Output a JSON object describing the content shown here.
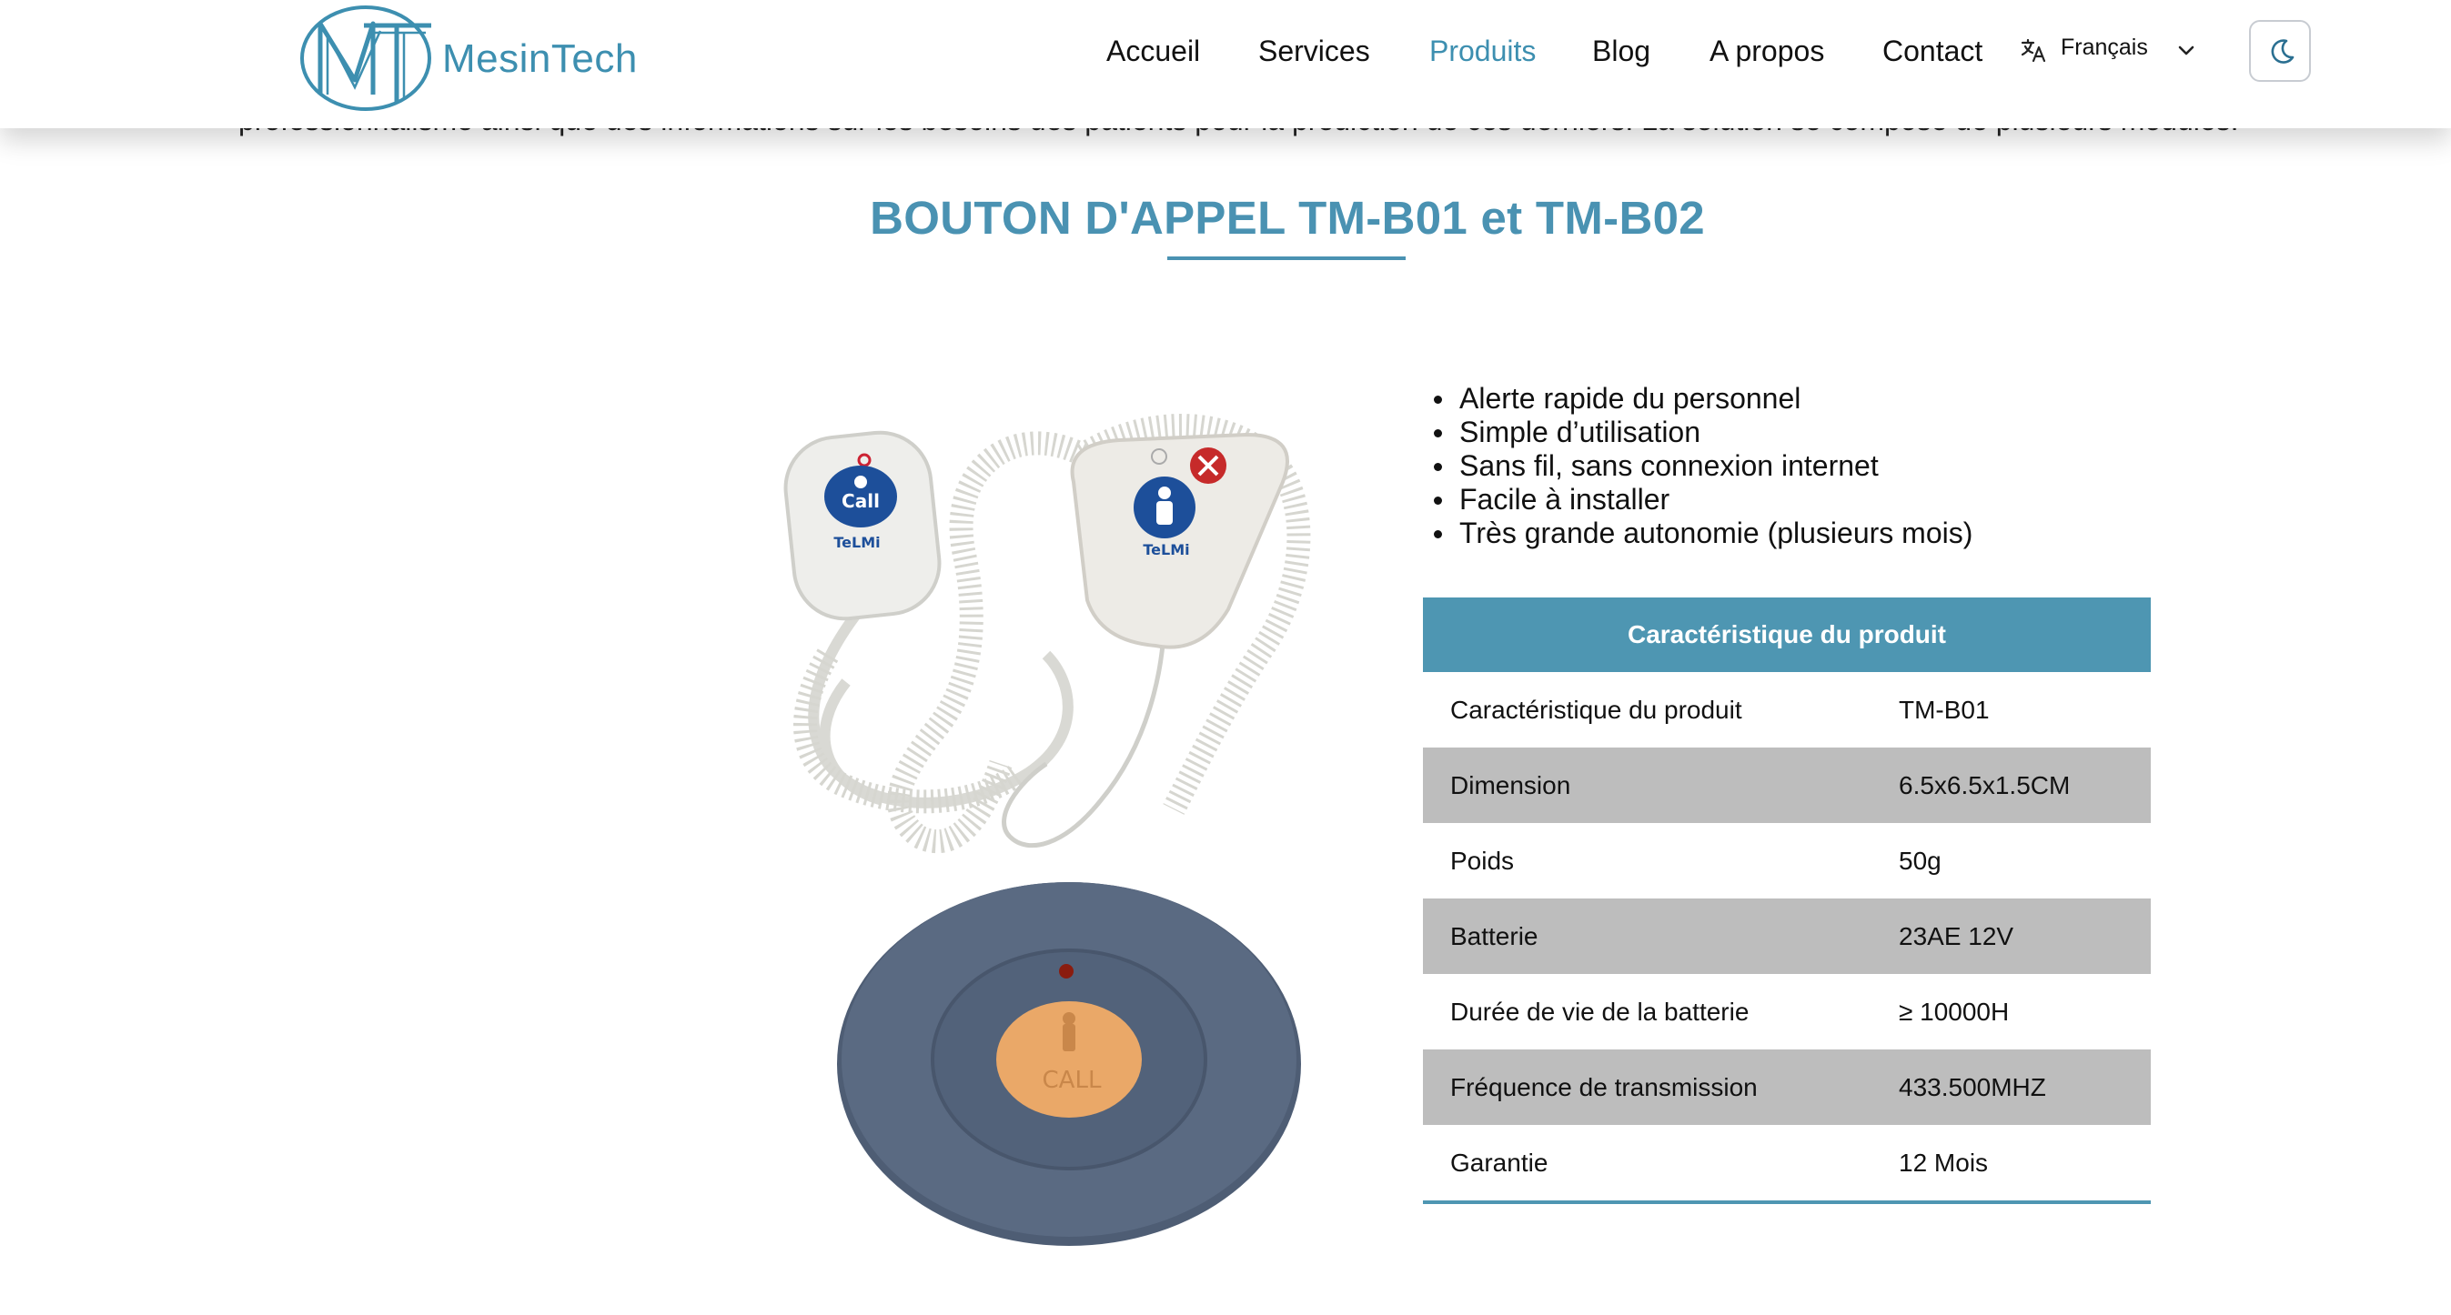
{
  "intro_text_fragment": "professionnalisme ainsi que des informations sur les besoins des patients pour la prédiction de ces derniers. La solution se compose de plusieurs modules.",
  "header": {
    "logo_text": "MesinTech",
    "nav": [
      {
        "label": "Accueil"
      },
      {
        "label": "Services"
      },
      {
        "label": "Produits",
        "active": true
      },
      {
        "label": "Blog"
      },
      {
        "label": "A propos"
      },
      {
        "label": "Contact"
      }
    ],
    "language": {
      "selected": "Français",
      "icon": "translate-icon"
    },
    "theme_toggle_icon": "moon-icon",
    "accent_color": "#3d8fb0"
  },
  "page_title": "BOUTON D'APPEL TM-B01 et TM-B02",
  "product_image": {
    "pendant_labels": {
      "call_small": "Call",
      "brand": "TeLMi"
    },
    "disc_button_label": "CALL"
  },
  "features": [
    "Alerte rapide du personnel",
    "Simple d’utilisation",
    "Sans fil, sans connexion internet",
    "Facile à installer",
    "Très grande autonomie (plusieurs mois)"
  ],
  "spec_table": {
    "header": "Caractéristique du produit",
    "header_color": "#4e96b2",
    "rows": [
      {
        "key": "Caractéristique du produit",
        "value": "TM-B01"
      },
      {
        "key": "Dimension",
        "value": "6.5x6.5x1.5CM"
      },
      {
        "key": "Poids",
        "value": "50g"
      },
      {
        "key": "Batterie",
        "value": "23AE 12V"
      },
      {
        "key": "Durée de vie de la batterie",
        "value": "≥ 10000H"
      },
      {
        "key": "Fréquence de transmission",
        "value": "433.500MHZ"
      },
      {
        "key": "Garantie",
        "value": "12 Mois"
      }
    ]
  }
}
